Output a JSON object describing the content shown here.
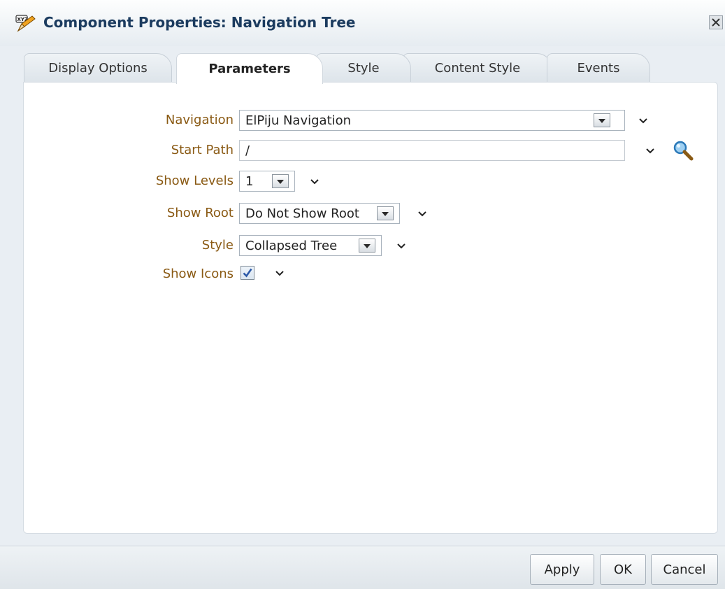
{
  "dialog": {
    "title": "Component Properties: Navigation Tree",
    "icon": "xyz-pencil-icon",
    "close_icon": "close-icon"
  },
  "tabs": [
    {
      "label": "Display Options",
      "active": false
    },
    {
      "label": "Parameters",
      "active": true
    },
    {
      "label": "Style",
      "active": false
    },
    {
      "label": "Content Style",
      "active": false
    },
    {
      "label": "Events",
      "active": false
    }
  ],
  "form": {
    "navigation": {
      "label": "Navigation",
      "value": "ElPiju Navigation"
    },
    "start_path": {
      "label": "Start Path",
      "value": "/"
    },
    "show_levels": {
      "label": "Show Levels",
      "value": "1"
    },
    "show_root": {
      "label": "Show Root",
      "value": "Do Not Show Root"
    },
    "style": {
      "label": "Style",
      "value": "Collapsed Tree"
    },
    "show_icons": {
      "label": "Show Icons",
      "checked": true
    }
  },
  "buttons": {
    "apply": "Apply",
    "ok": "OK",
    "cancel": "Cancel"
  },
  "colors": {
    "label": "#8a5a14",
    "title": "#1b3b5f"
  }
}
